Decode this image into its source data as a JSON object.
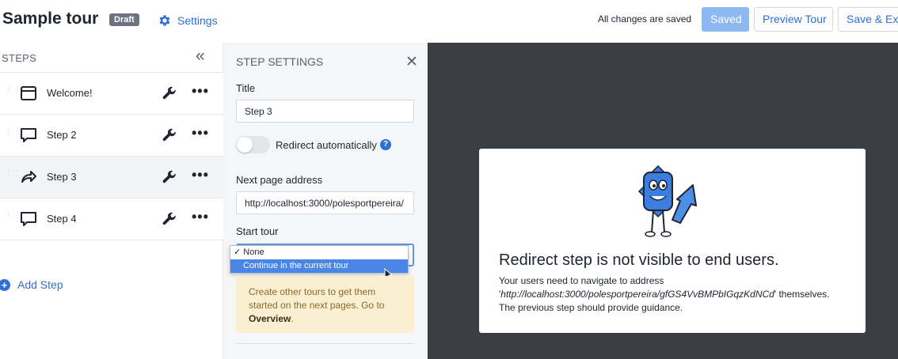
{
  "header": {
    "title": "Sample tour",
    "badge": "Draft",
    "settings_label": "Settings",
    "save_status": "All changes are saved",
    "saved_button": "Saved",
    "preview_button": "Preview Tour",
    "exit_button": "Save & Exit"
  },
  "steps_panel": {
    "heading": "STEPS",
    "collapse_icon": "double-chevron-left-icon",
    "items": [
      {
        "label": "Welcome!",
        "icon": "window-icon",
        "active": false
      },
      {
        "label": "Step 2",
        "icon": "speech-bubble-icon",
        "active": false
      },
      {
        "label": "Step 3",
        "icon": "redirect-arrow-icon",
        "active": true
      },
      {
        "label": "Step 4",
        "icon": "speech-bubble-icon",
        "active": false
      }
    ],
    "more_glyph": "•••",
    "add_step": "Add Step"
  },
  "step_settings": {
    "heading": "STEP SETTINGS",
    "title_label": "Title",
    "title_value": "Step 3",
    "redirect_label": "Redirect automatically",
    "redirect_on": false,
    "next_page_label": "Next page address",
    "next_page_value": "http://localhost:3000/polesportpereira/",
    "start_tour_label": "Start tour",
    "start_tour_options": [
      "✓ None",
      "Continue in the current tour"
    ],
    "note_text": "Create other tours to get them started on the next pages. Go to ",
    "note_link": "Overview",
    "note_end": "."
  },
  "preview": {
    "heading": "Redirect step is not visible to end users.",
    "text_1": "Your users need to navigate to address",
    "quote_open": "'",
    "url": "http://localhost:3000/polesportpereira/gfGS4VvBMPbIGqzKdNCd",
    "text_2": "' themselves.",
    "text_3": "The previous step should provide guidance."
  },
  "colors": {
    "accent": "#2f6fd6",
    "saved_button": "#8db8f2",
    "preview_bg": "#3b3e43",
    "note_bg": "#fbefd1",
    "draft_badge": "#6b7280"
  }
}
